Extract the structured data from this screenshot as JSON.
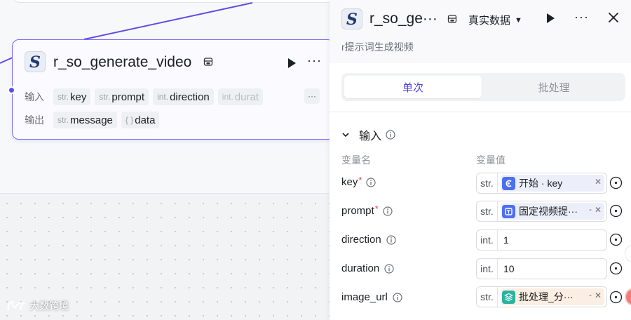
{
  "canvas": {
    "node": {
      "title": "r_so_generate_video",
      "io_input_label": "输入",
      "io_output_label": "输出",
      "inputs": [
        {
          "type": "str.",
          "name": "key"
        },
        {
          "type": "str.",
          "name": "prompt"
        },
        {
          "type": "int.",
          "name": "direction"
        },
        {
          "type": "int.",
          "name": "durat"
        }
      ],
      "more_inputs_label": "···",
      "outputs": [
        {
          "type": "str.",
          "name": "message"
        },
        {
          "type": "{ }",
          "name": "data"
        }
      ],
      "more_label": "···"
    },
    "watermark": "大数跨境",
    "edge_color": "#5b4ee6"
  },
  "panel": {
    "title": "r_so_ge···",
    "data_mode": "真实数据",
    "description": "r提示词生成视频",
    "more_label": "···",
    "tabs": [
      {
        "label": "单次",
        "active": true
      },
      {
        "label": "批处理",
        "active": false
      }
    ],
    "section_title": "输入",
    "col_name": "变量名",
    "col_value": "变量值",
    "variables": [
      {
        "name": "key",
        "required": "*",
        "type": "str.",
        "kind": "ref",
        "ref_text": "开始 · key",
        "ref_icon": "start-node-icon",
        "chip_color": "#4e6ef2"
      },
      {
        "name": "prompt",
        "required": "*",
        "type": "str.",
        "kind": "ref",
        "ref_text": "固定视频提···",
        "ref_icon": "text-node-icon",
        "chip_color": "#4e6ef2"
      },
      {
        "name": "direction",
        "required": "",
        "type": "int.",
        "kind": "value",
        "value": "1"
      },
      {
        "name": "duration",
        "required": "",
        "type": "int.",
        "kind": "value",
        "value": "10"
      },
      {
        "name": "image_url",
        "required": "",
        "type": "str.",
        "kind": "ref",
        "ref_text": "批处理_分···",
        "ref_icon": "batch-node-icon",
        "chip_color": "#2bb3a0"
      }
    ],
    "accent_color": "#4e40e5"
  }
}
